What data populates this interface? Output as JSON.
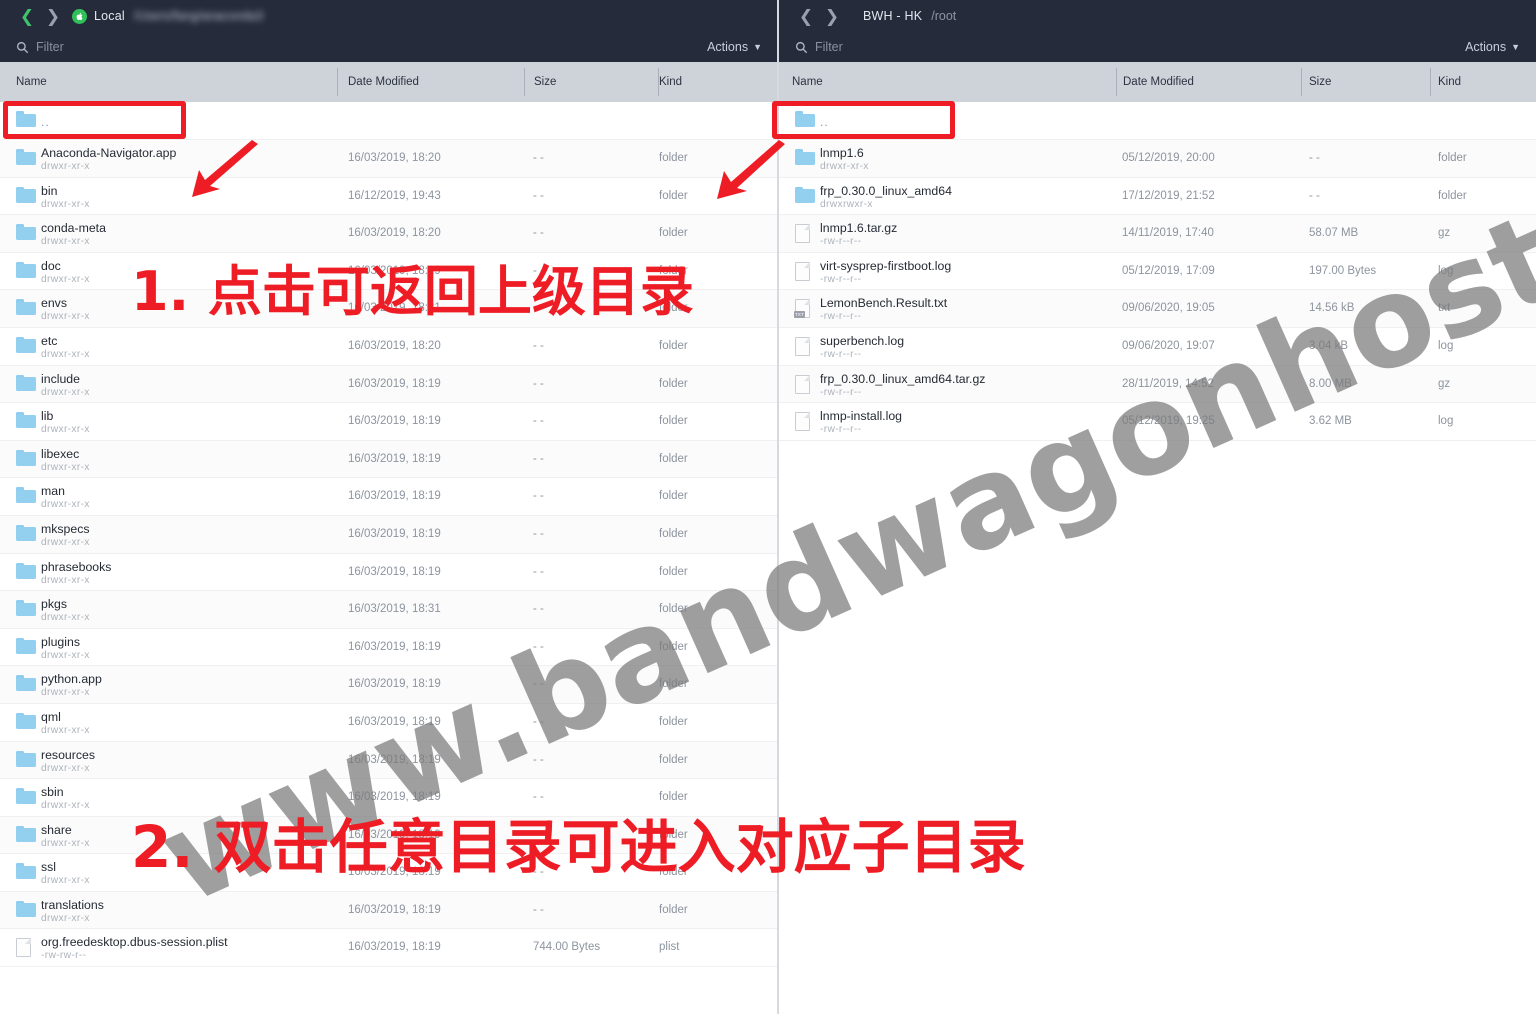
{
  "left_pane": {
    "nav": {
      "back_icon": "chevron-left-icon",
      "forward_icon": "chevron-right-icon",
      "host_badge_icon": "apple-logo-icon",
      "host_label": "Local",
      "path": "/Users/fang/anaconda3"
    },
    "filter": {
      "icon": "search-icon",
      "placeholder": "Filter",
      "value": ""
    },
    "actions": {
      "label": "Actions",
      "caret_icon": "chevron-down-icon"
    },
    "columns": [
      "Name",
      "Date Modified",
      "Size",
      "Kind"
    ],
    "rows": [
      {
        "name": "..",
        "perm": "",
        "date": "",
        "size": "",
        "kind": "",
        "icon": "folder-icon"
      },
      {
        "name": "Anaconda-Navigator.app",
        "perm": "drwxr-xr-x",
        "date": "16/03/2019, 18:20",
        "size": "- -",
        "kind": "folder",
        "icon": "folder-icon"
      },
      {
        "name": "bin",
        "perm": "drwxr-xr-x",
        "date": "16/12/2019, 19:43",
        "size": "- -",
        "kind": "folder",
        "icon": "folder-icon"
      },
      {
        "name": "conda-meta",
        "perm": "drwxr-xr-x",
        "date": "16/03/2019, 18:20",
        "size": "- -",
        "kind": "folder",
        "icon": "folder-icon"
      },
      {
        "name": "doc",
        "perm": "drwxr-xr-x",
        "date": "16/03/2019, 18:19",
        "size": "- -",
        "kind": "folder",
        "icon": "folder-icon"
      },
      {
        "name": "envs",
        "perm": "drwxr-xr-x",
        "date": "16/03/2019, 18:31",
        "size": "- -",
        "kind": "folder",
        "icon": "folder-icon"
      },
      {
        "name": "etc",
        "perm": "drwxr-xr-x",
        "date": "16/03/2019, 18:20",
        "size": "- -",
        "kind": "folder",
        "icon": "folder-icon"
      },
      {
        "name": "include",
        "perm": "drwxr-xr-x",
        "date": "16/03/2019, 18:19",
        "size": "- -",
        "kind": "folder",
        "icon": "folder-icon"
      },
      {
        "name": "lib",
        "perm": "drwxr-xr-x",
        "date": "16/03/2019, 18:19",
        "size": "- -",
        "kind": "folder",
        "icon": "folder-icon"
      },
      {
        "name": "libexec",
        "perm": "drwxr-xr-x",
        "date": "16/03/2019, 18:19",
        "size": "- -",
        "kind": "folder",
        "icon": "folder-icon"
      },
      {
        "name": "man",
        "perm": "drwxr-xr-x",
        "date": "16/03/2019, 18:19",
        "size": "- -",
        "kind": "folder",
        "icon": "folder-icon"
      },
      {
        "name": "mkspecs",
        "perm": "drwxr-xr-x",
        "date": "16/03/2019, 18:19",
        "size": "- -",
        "kind": "folder",
        "icon": "folder-icon"
      },
      {
        "name": "phrasebooks",
        "perm": "drwxr-xr-x",
        "date": "16/03/2019, 18:19",
        "size": "- -",
        "kind": "folder",
        "icon": "folder-icon"
      },
      {
        "name": "pkgs",
        "perm": "drwxr-xr-x",
        "date": "16/03/2019, 18:31",
        "size": "- -",
        "kind": "folder",
        "icon": "folder-icon"
      },
      {
        "name": "plugins",
        "perm": "drwxr-xr-x",
        "date": "16/03/2019, 18:19",
        "size": "- -",
        "kind": "folder",
        "icon": "folder-icon"
      },
      {
        "name": "python.app",
        "perm": "drwxr-xr-x",
        "date": "16/03/2019, 18:19",
        "size": "- -",
        "kind": "folder",
        "icon": "folder-icon"
      },
      {
        "name": "qml",
        "perm": "drwxr-xr-x",
        "date": "16/03/2019, 18:19",
        "size": "- -",
        "kind": "folder",
        "icon": "folder-icon"
      },
      {
        "name": "resources",
        "perm": "drwxr-xr-x",
        "date": "16/03/2019, 18:19",
        "size": "- -",
        "kind": "folder",
        "icon": "folder-icon"
      },
      {
        "name": "sbin",
        "perm": "drwxr-xr-x",
        "date": "16/03/2019, 18:19",
        "size": "- -",
        "kind": "folder",
        "icon": "folder-icon"
      },
      {
        "name": "share",
        "perm": "drwxr-xr-x",
        "date": "16/03/2019, 18:19",
        "size": "- -",
        "kind": "folder",
        "icon": "folder-icon"
      },
      {
        "name": "ssl",
        "perm": "drwxr-xr-x",
        "date": "16/03/2019, 18:19",
        "size": "- -",
        "kind": "folder",
        "icon": "folder-icon"
      },
      {
        "name": "translations",
        "perm": "drwxr-xr-x",
        "date": "16/03/2019, 18:19",
        "size": "- -",
        "kind": "folder",
        "icon": "folder-icon"
      },
      {
        "name": "org.freedesktop.dbus-session.plist",
        "perm": "-rw-rw-r--",
        "date": "16/03/2019, 18:19",
        "size": "744.00 Bytes",
        "kind": "plist",
        "icon": "file-icon"
      }
    ]
  },
  "right_pane": {
    "nav": {
      "back_icon": "chevron-left-icon",
      "forward_icon": "chevron-right-icon",
      "host_label": "BWH - HK",
      "path": "/root"
    },
    "filter": {
      "icon": "search-icon",
      "placeholder": "Filter",
      "value": ""
    },
    "actions": {
      "label": "Actions",
      "caret_icon": "chevron-down-icon"
    },
    "columns": [
      "Name",
      "Date Modified",
      "Size",
      "Kind"
    ],
    "rows": [
      {
        "name": "..",
        "perm": "",
        "date": "",
        "size": "",
        "kind": "",
        "icon": "folder-icon"
      },
      {
        "name": "lnmp1.6",
        "perm": "drwxr-xr-x",
        "date": "05/12/2019, 20:00",
        "size": "- -",
        "kind": "folder",
        "icon": "folder-icon"
      },
      {
        "name": "frp_0.30.0_linux_amd64",
        "perm": "drwxrwxr-x",
        "date": "17/12/2019, 21:52",
        "size": "- -",
        "kind": "folder",
        "icon": "folder-icon"
      },
      {
        "name": "lnmp1.6.tar.gz",
        "perm": "-rw-r--r--",
        "date": "14/11/2019, 17:40",
        "size": "58.07 MB",
        "kind": "gz",
        "icon": "file-icon"
      },
      {
        "name": "virt-sysprep-firstboot.log",
        "perm": "-rw-r--r--",
        "date": "05/12/2019, 17:09",
        "size": "197.00 Bytes",
        "kind": "log",
        "icon": "file-icon"
      },
      {
        "name": "LemonBench.Result.txt",
        "perm": "-rw-r--r--",
        "date": "09/06/2020, 19:05",
        "size": "14.56 kB",
        "kind": "txt",
        "icon": "file-icon",
        "badge": "TXT"
      },
      {
        "name": "superbench.log",
        "perm": "-rw-r--r--",
        "date": "09/06/2020, 19:07",
        "size": "3.04 kB",
        "kind": "log",
        "icon": "file-icon"
      },
      {
        "name": "frp_0.30.0_linux_amd64.tar.gz",
        "perm": "-rw-r--r--",
        "date": "28/11/2019, 14:52",
        "size": "8.00 MB",
        "kind": "gz",
        "icon": "file-icon"
      },
      {
        "name": "lnmp-install.log",
        "perm": "-rw-r--r--",
        "date": "05/12/2019, 19:25",
        "size": "3.62 MB",
        "kind": "log",
        "icon": "file-icon"
      }
    ]
  },
  "annotations": {
    "color": "#ee1c25",
    "step1_text": "1. 点击可返回上级目录",
    "step2_text": "2. 双击任意目录可进入对应子目录"
  },
  "watermark": {
    "text": "www.bandwagonhost.net",
    "color": "#7b7b7b"
  }
}
